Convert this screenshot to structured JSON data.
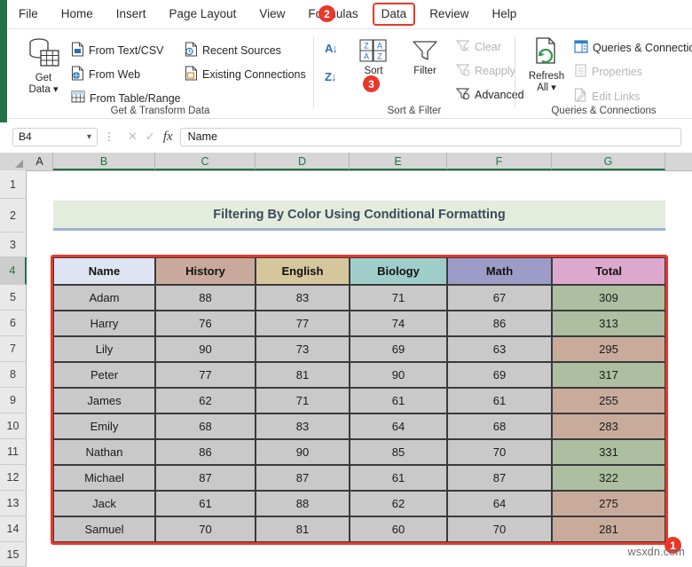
{
  "app": {
    "name_box_value": "B4",
    "formula_bar_value": "Name"
  },
  "ribbon": {
    "tabs": [
      {
        "label": "File",
        "active": false
      },
      {
        "label": "Home",
        "active": false
      },
      {
        "label": "Insert",
        "active": false
      },
      {
        "label": "Page Layout",
        "active": false
      },
      {
        "label": "View",
        "active": false
      },
      {
        "label": "Formulas",
        "active": false
      },
      {
        "label": "Data",
        "active": true
      },
      {
        "label": "Review",
        "active": false
      },
      {
        "label": "Help",
        "active": false
      }
    ],
    "groups": [
      {
        "label": "Get & Transform Data",
        "big_button": {
          "line1": "Get",
          "line2": "Data",
          "caret": "⌄"
        },
        "items": [
          {
            "label": "From Text/CSV",
            "icon": "text-csv-icon",
            "disabled": false
          },
          {
            "label": "From Web",
            "icon": "web-icon",
            "disabled": false
          },
          {
            "label": "From Table/Range",
            "icon": "table-range-icon",
            "disabled": false
          },
          {
            "label": "Recent Sources",
            "icon": "recent-sources-icon",
            "disabled": false
          },
          {
            "label": "Existing Connections",
            "icon": "existing-connections-icon",
            "disabled": false
          }
        ]
      },
      {
        "label": "Sort & Filter",
        "sort_az": "A↓",
        "sort_za": "Z↓",
        "sort_button": "Sort",
        "filter_button": "Filter",
        "items": [
          {
            "label": "Clear",
            "icon": "clear-filter-icon",
            "disabled": true
          },
          {
            "label": "Reapply",
            "icon": "reapply-filter-icon",
            "disabled": true
          },
          {
            "label": "Advanced",
            "icon": "advanced-filter-icon",
            "disabled": false
          }
        ]
      },
      {
        "label": "Queries & Connections",
        "big_button": {
          "line1": "Refresh",
          "line2": "All",
          "caret": "⌄"
        },
        "items": [
          {
            "label": "Queries & Connections",
            "icon": "queries-connections-icon",
            "disabled": false
          },
          {
            "label": "Properties",
            "icon": "properties-icon",
            "disabled": true
          },
          {
            "label": "Edit Links",
            "icon": "edit-links-icon",
            "disabled": true
          }
        ]
      }
    ]
  },
  "sheet": {
    "column_headers": [
      "A",
      "B",
      "C",
      "D",
      "E",
      "F",
      "G"
    ],
    "selected_columns": [
      "B",
      "C",
      "D",
      "E",
      "F",
      "G"
    ],
    "row_headers": [
      "1",
      "2",
      "3",
      "4",
      "5",
      "6",
      "7",
      "8",
      "9",
      "10",
      "11",
      "12",
      "13",
      "14",
      "15"
    ],
    "selected_row": "4",
    "title": "Filtering By Color Using Conditional Formatting",
    "table": {
      "headers": [
        "Name",
        "History",
        "English",
        "Biology",
        "Math",
        "Total"
      ],
      "header_colors": [
        "#dfe4f2",
        "#c9a99c",
        "#d5c69c",
        "#9fcdca",
        "#9d9cc8",
        "#dca8cd"
      ],
      "rows": [
        {
          "name": "Adam",
          "history": "88",
          "english": "83",
          "biology": "71",
          "math": "67",
          "total": "309",
          "total_color": "#aebea0"
        },
        {
          "name": "Harry",
          "history": "76",
          "english": "77",
          "biology": "74",
          "math": "86",
          "total": "313",
          "total_color": "#aebea0"
        },
        {
          "name": "Lily",
          "history": "90",
          "english": "73",
          "biology": "69",
          "math": "63",
          "total": "295",
          "total_color": "#c9ab9c"
        },
        {
          "name": "Peter",
          "history": "77",
          "english": "81",
          "biology": "90",
          "math": "69",
          "total": "317",
          "total_color": "#aebea0"
        },
        {
          "name": "James",
          "history": "62",
          "english": "71",
          "biology": "61",
          "math": "61",
          "total": "255",
          "total_color": "#c9ab9c"
        },
        {
          "name": "Emily",
          "history": "68",
          "english": "83",
          "biology": "64",
          "math": "68",
          "total": "283",
          "total_color": "#c9ab9c"
        },
        {
          "name": "Nathan",
          "history": "86",
          "english": "90",
          "biology": "85",
          "math": "70",
          "total": "331",
          "total_color": "#aebea0"
        },
        {
          "name": "Michael",
          "history": "87",
          "english": "87",
          "biology": "61",
          "math": "87",
          "total": "322",
          "total_color": "#aebea0"
        },
        {
          "name": "Jack",
          "history": "61",
          "english": "88",
          "biology": "62",
          "math": "64",
          "total": "275",
          "total_color": "#c9ab9c"
        },
        {
          "name": "Samuel",
          "history": "70",
          "english": "81",
          "biology": "60",
          "math": "70",
          "total": "281",
          "total_color": "#c9ab9c"
        }
      ]
    }
  },
  "annotations": {
    "badge_table": "1",
    "badge_data_tab": "2",
    "badge_filter": "3"
  },
  "watermark": "wsxdn.com",
  "colors": {
    "accent_red": "#e8382b",
    "excel_green": "#217346",
    "title_bg": "#e4ecdc",
    "title_text": "#3b4b5e",
    "data_cell_bg": "#c9c9c9"
  }
}
